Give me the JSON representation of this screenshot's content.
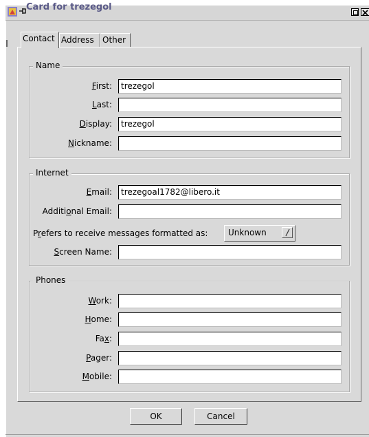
{
  "window": {
    "title": "Card for trezegol",
    "app_icon": "app-icon",
    "pin_icon": "pin-icon"
  },
  "tabs": [
    {
      "label": "Contact",
      "active": true
    },
    {
      "label": "Address",
      "active": false
    },
    {
      "label": "Other",
      "active": false
    }
  ],
  "name_group": {
    "legend": "Name",
    "first": {
      "label_pre": "",
      "label_u": "F",
      "label_post": "irst:",
      "value": "trezegol"
    },
    "last": {
      "label_pre": "",
      "label_u": "L",
      "label_post": "ast:",
      "value": ""
    },
    "display": {
      "label_pre": "",
      "label_u": "D",
      "label_post": "isplay:",
      "value": "trezegol"
    },
    "nickname": {
      "label_pre": "",
      "label_u": "N",
      "label_post": "ickname:",
      "value": ""
    }
  },
  "internet_group": {
    "legend": "Internet",
    "email": {
      "label_pre": "",
      "label_u": "E",
      "label_post": "mail:",
      "value": "trezegoal1782@libero.it"
    },
    "additional_email": {
      "label_pre": "Additi",
      "label_u": "o",
      "label_post": "nal Email:",
      "value": ""
    },
    "prefers": {
      "label_pre": "P",
      "label_u": "r",
      "label_post": "efers to receive messages formatted as:",
      "value": "Unknown"
    },
    "screen_name": {
      "label_pre": "",
      "label_u": "S",
      "label_post": "creen Name:",
      "value": ""
    }
  },
  "phones_group": {
    "legend": "Phones",
    "work": {
      "label_pre": "",
      "label_u": "W",
      "label_post": "ork:",
      "value": ""
    },
    "home": {
      "label_pre": "",
      "label_u": "H",
      "label_post": "ome:",
      "value": ""
    },
    "fax": {
      "label_pre": "Fa",
      "label_u": "x",
      "label_post": ":",
      "value": ""
    },
    "pager": {
      "label_pre": "",
      "label_u": "P",
      "label_post": "ager:",
      "value": ""
    },
    "mobile": {
      "label_pre": "",
      "label_u": "M",
      "label_post": "obile:",
      "value": ""
    }
  },
  "buttons": {
    "ok": "OK",
    "cancel": "Cancel"
  },
  "colors": {
    "background": "#d9d9d9",
    "title_text": "#5a5a88"
  }
}
